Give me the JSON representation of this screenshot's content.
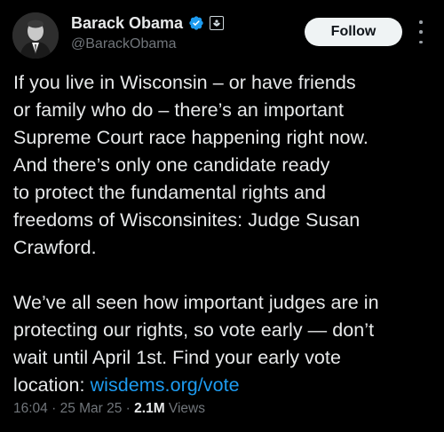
{
  "author": {
    "display_name": "Barack Obama",
    "handle": "@BarackObama"
  },
  "actions": {
    "follow_label": "Follow"
  },
  "icons": {
    "verified": "verified-badge-icon",
    "affiliation": "government-affiliation-icon",
    "more": "more-options-icon"
  },
  "colors": {
    "background": "#000000",
    "text": "#e7e9ea",
    "muted": "#71767b",
    "link": "#1d9bf0",
    "verified": "#1d9bf0",
    "follow_bg": "#eff3f4"
  },
  "tweet": {
    "lines": [
      "If you live in Wisconsin – or have friends",
      "or family who do – there’s an important",
      "Supreme Court race happening right now.",
      "And there’s only one candidate ready",
      "to protect the fundamental rights and",
      "freedoms of Wisconsinites: Judge Susan",
      "Crawford.",
      "We’ve all seen how important judges are in",
      "protecting our rights, so vote early — don’t",
      "wait until April 1st. Find your early vote"
    ],
    "last_line_prefix": "location: ",
    "link": "wisdems.org/vote"
  },
  "meta": {
    "time": "16:04",
    "sep1": " · ",
    "date": "25 Mar 25",
    "sep2": " · ",
    "views_count": "2.1M",
    "views_label": " Views"
  }
}
